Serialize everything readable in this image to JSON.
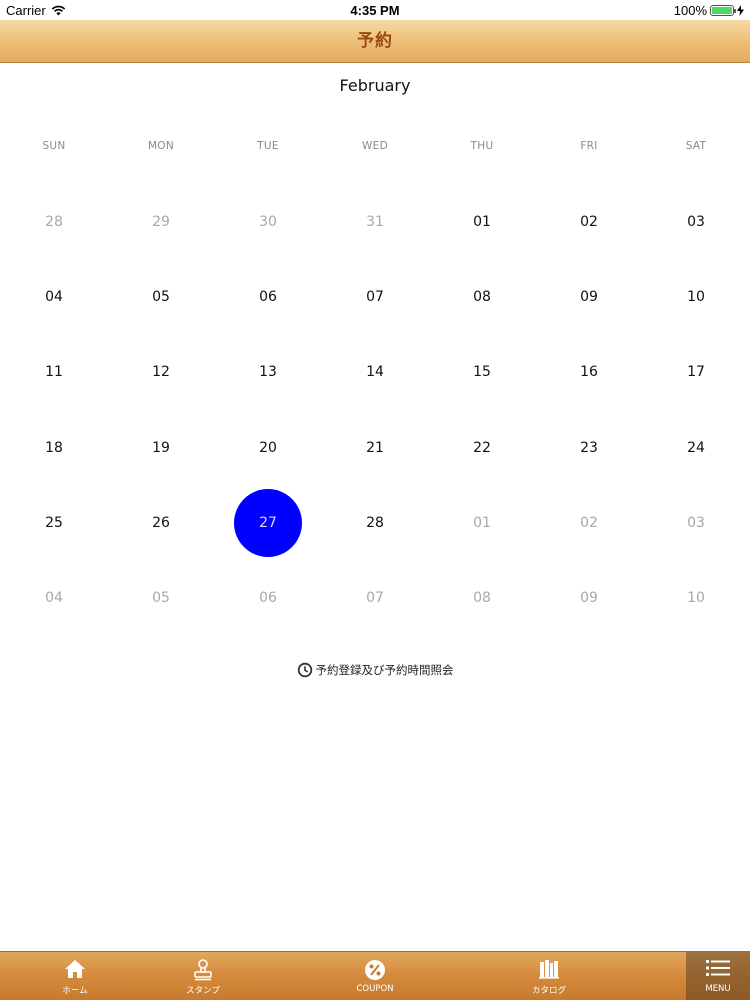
{
  "status": {
    "carrier": "Carrier",
    "time": "4:35 PM",
    "battery": "100%"
  },
  "header": {
    "title": "予約"
  },
  "calendar": {
    "month": "February",
    "weekdays": [
      "SUN",
      "MON",
      "TUE",
      "WED",
      "THU",
      "FRI",
      "SAT"
    ],
    "weeks": [
      [
        {
          "d": "28",
          "m": true
        },
        {
          "d": "29",
          "m": true
        },
        {
          "d": "30",
          "m": true
        },
        {
          "d": "31",
          "m": true
        },
        {
          "d": "01"
        },
        {
          "d": "02"
        },
        {
          "d": "03"
        }
      ],
      [
        {
          "d": "04"
        },
        {
          "d": "05"
        },
        {
          "d": "06"
        },
        {
          "d": "07"
        },
        {
          "d": "08"
        },
        {
          "d": "09"
        },
        {
          "d": "10"
        }
      ],
      [
        {
          "d": "11"
        },
        {
          "d": "12"
        },
        {
          "d": "13"
        },
        {
          "d": "14"
        },
        {
          "d": "15"
        },
        {
          "d": "16"
        },
        {
          "d": "17"
        }
      ],
      [
        {
          "d": "18"
        },
        {
          "d": "19"
        },
        {
          "d": "20"
        },
        {
          "d": "21"
        },
        {
          "d": "22"
        },
        {
          "d": "23"
        },
        {
          "d": "24"
        }
      ],
      [
        {
          "d": "25"
        },
        {
          "d": "26"
        },
        {
          "d": "27",
          "s": true
        },
        {
          "d": "28"
        },
        {
          "d": "01",
          "m": true
        },
        {
          "d": "02",
          "m": true
        },
        {
          "d": "03",
          "m": true
        }
      ],
      [
        {
          "d": "04",
          "m": true
        },
        {
          "d": "05",
          "m": true
        },
        {
          "d": "06",
          "m": true
        },
        {
          "d": "07",
          "m": true
        },
        {
          "d": "08",
          "m": true
        },
        {
          "d": "09",
          "m": true
        },
        {
          "d": "10",
          "m": true
        }
      ]
    ],
    "selected_color": "#0000ff"
  },
  "reservation_link": {
    "icon": "clock-icon",
    "label": "予約登録及び予約時間照会"
  },
  "tabbar": {
    "tabs": [
      {
        "key": "home",
        "label": "ホーム",
        "icon": "home-icon"
      },
      {
        "key": "stamp",
        "label": "スタンプ",
        "icon": "stamp-icon"
      },
      {
        "key": "coupon",
        "label": "COUPON",
        "icon": "percent-icon"
      },
      {
        "key": "catalog",
        "label": "カタログ",
        "icon": "books-icon"
      },
      {
        "key": "menu",
        "label": "MENU",
        "icon": "menu-icon",
        "active": true
      }
    ]
  }
}
